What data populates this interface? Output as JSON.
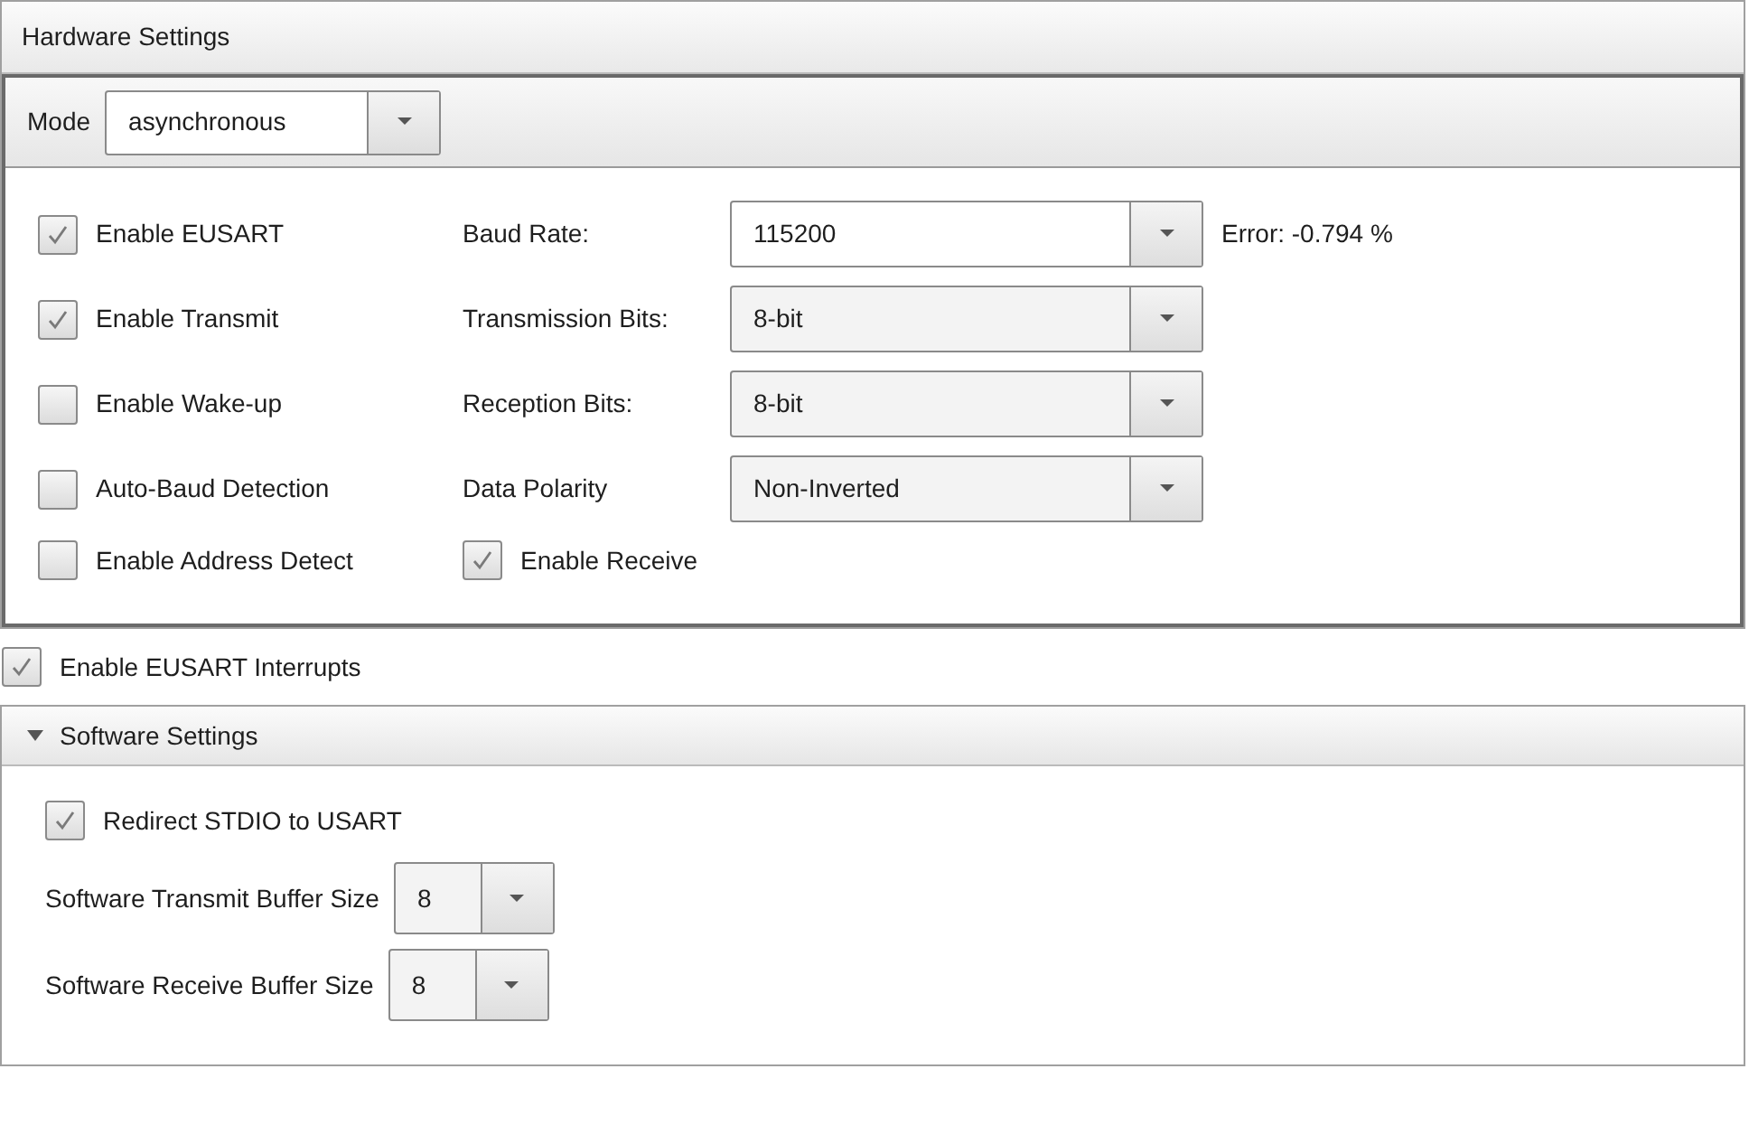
{
  "hardware_settings": {
    "title": "Hardware Settings",
    "mode": {
      "label": "Mode",
      "value": "asynchronous"
    },
    "checkboxes": [
      {
        "label": "Enable EUSART",
        "checked": true
      },
      {
        "label": "Enable Transmit",
        "checked": true
      },
      {
        "label": "Enable Wake-up",
        "checked": false
      },
      {
        "label": "Auto-Baud Detection",
        "checked": false
      },
      {
        "label": "Enable Address Detect",
        "checked": false
      }
    ],
    "fields": [
      {
        "label": "Baud Rate:",
        "value": "115200",
        "editable": true,
        "note": "Error: -0.794 %"
      },
      {
        "label": "Transmission Bits:",
        "value": "8-bit",
        "editable": false
      },
      {
        "label": "Reception Bits:",
        "value": "8-bit",
        "editable": false
      },
      {
        "label": "Data Polarity",
        "value": "Non-Inverted",
        "editable": false
      }
    ],
    "enable_receive": {
      "label": "Enable Receive",
      "checked": true
    }
  },
  "enable_interrupts": {
    "label": "Enable EUSART Interrupts",
    "checked": true
  },
  "software_settings": {
    "title": "Software Settings",
    "expanded": true,
    "redirect": {
      "label": "Redirect STDIO to USART",
      "checked": true
    },
    "buffers": [
      {
        "label": "Software Transmit Buffer Size",
        "value": "8"
      },
      {
        "label": "Software Receive Buffer Size",
        "value": "8"
      }
    ]
  }
}
